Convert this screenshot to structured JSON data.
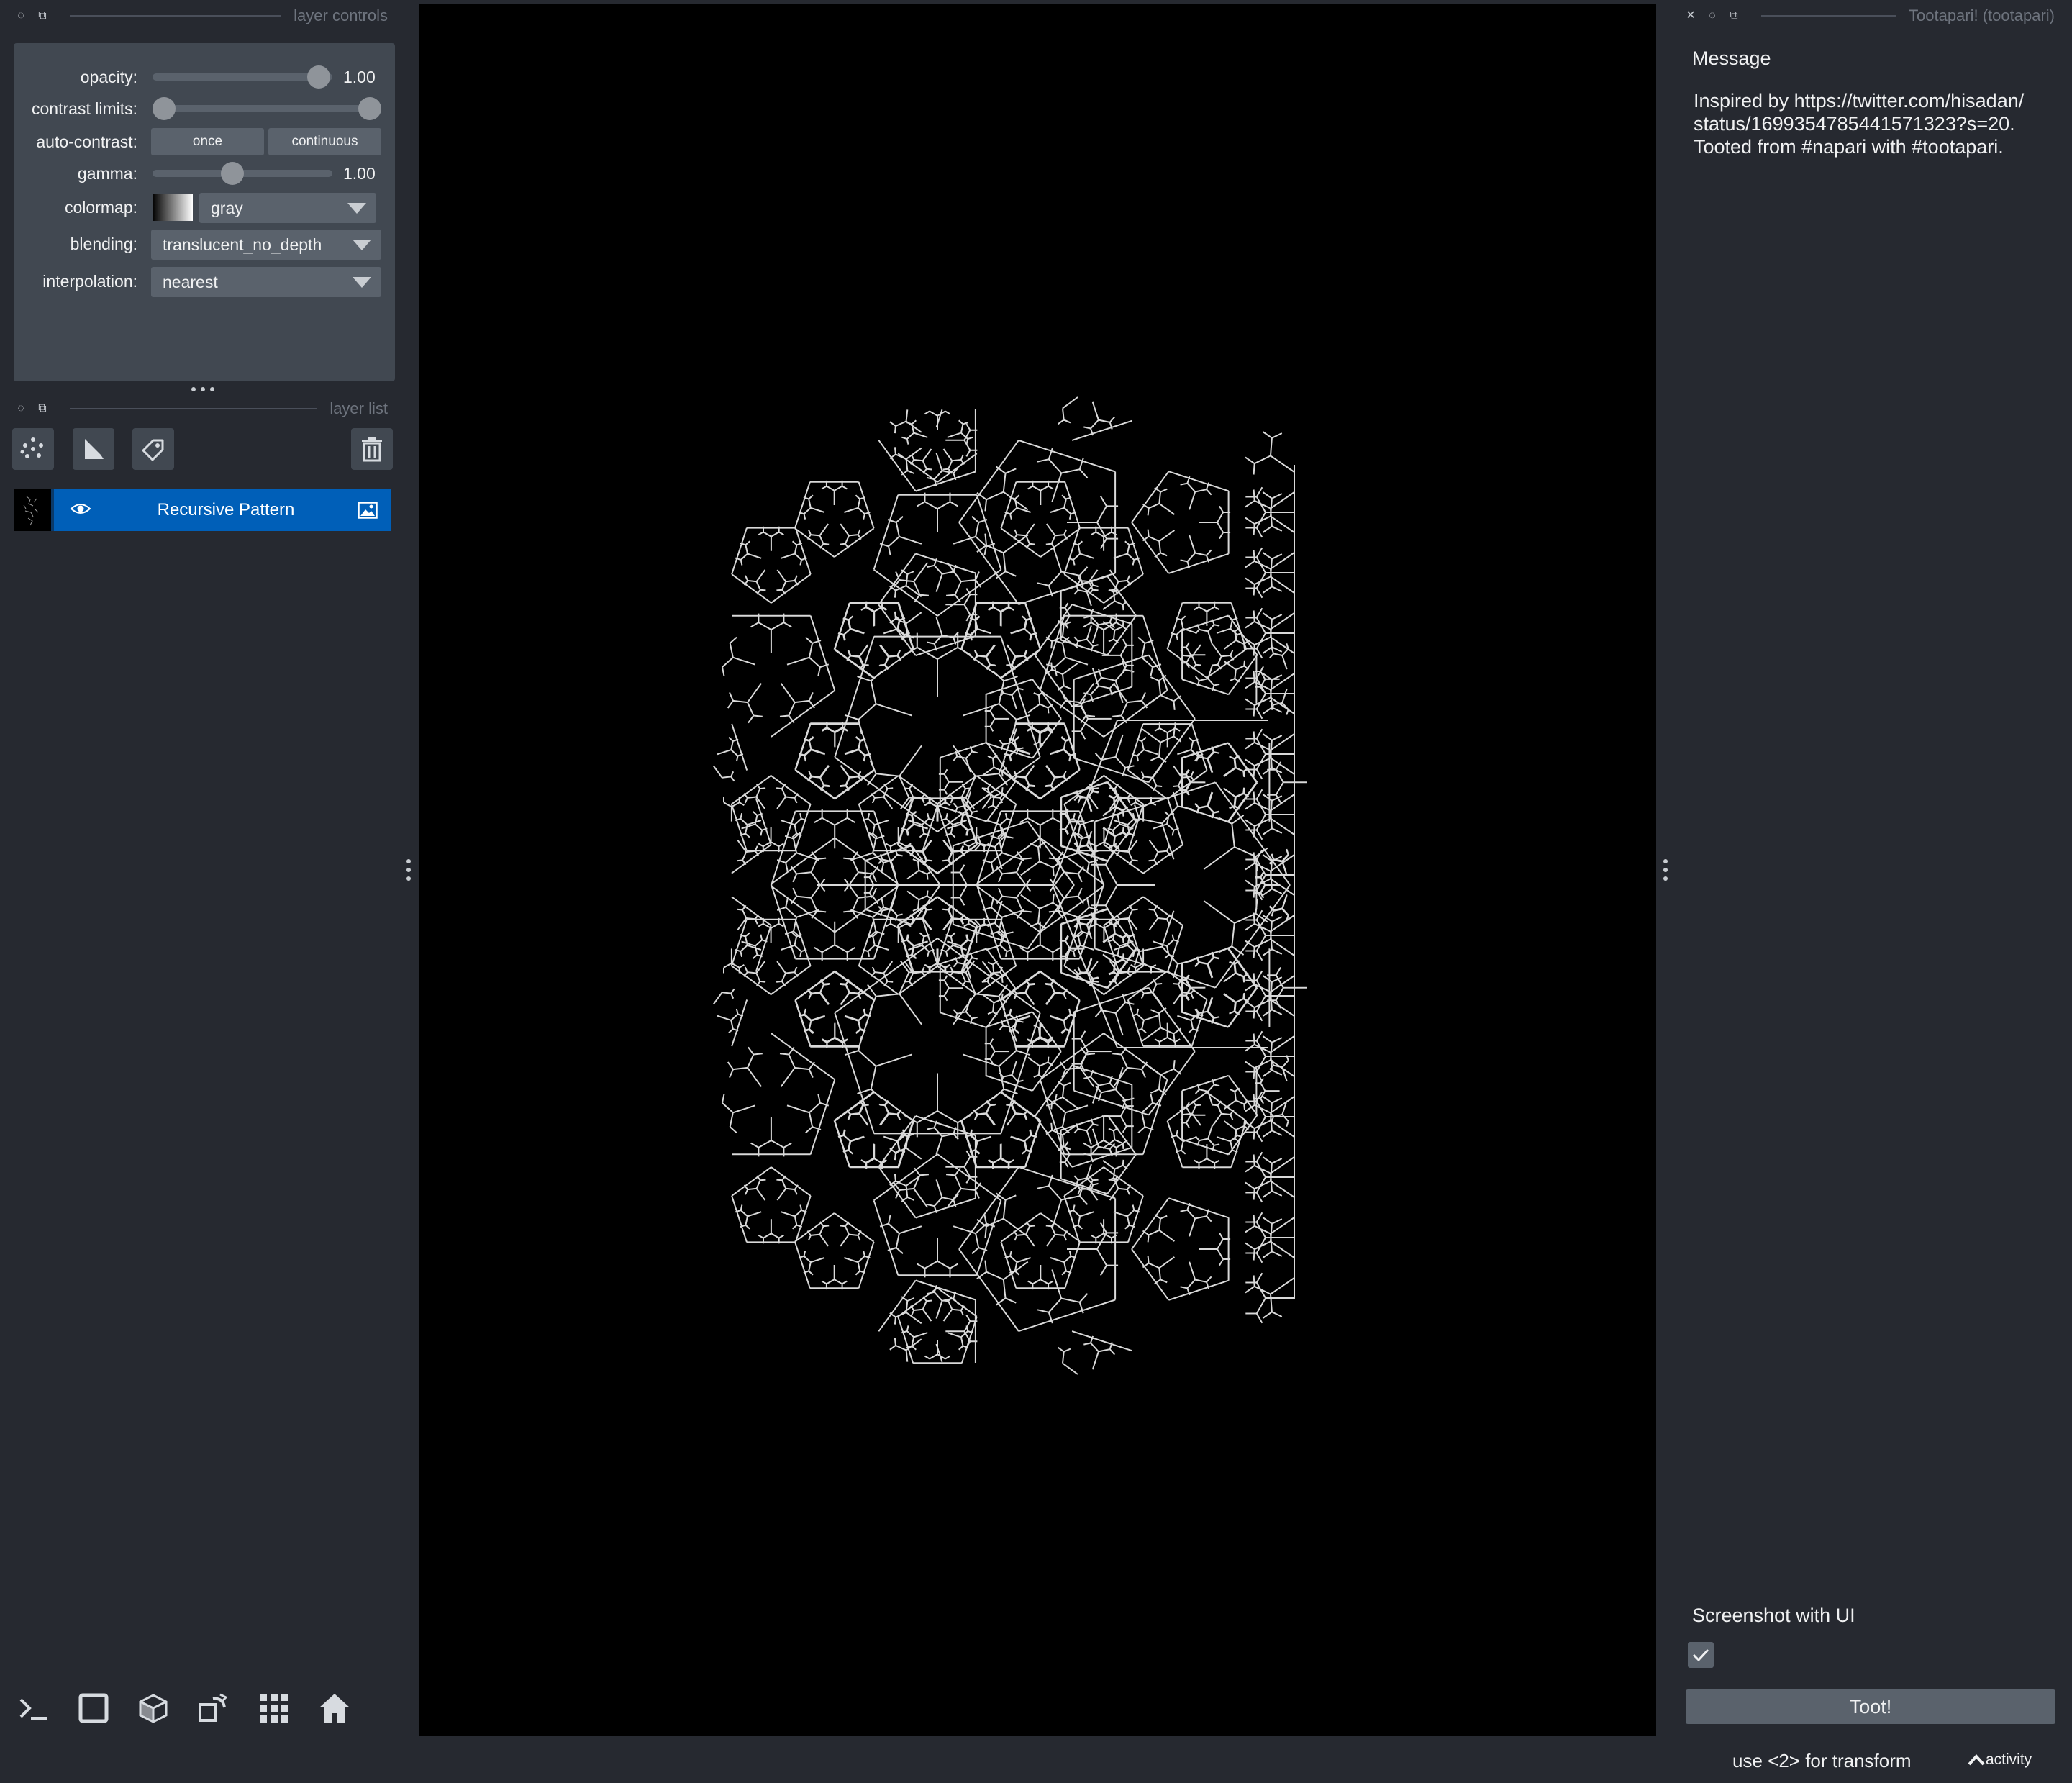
{
  "layer_controls": {
    "title": "layer controls",
    "opacity": {
      "label": "opacity:",
      "value": "1.00",
      "level": 1.0
    },
    "contrast_limits": {
      "label": "contrast limits:",
      "low": 0.0,
      "high": 1.0
    },
    "auto_contrast": {
      "label": "auto-contrast:",
      "once": "once",
      "continuous": "continuous"
    },
    "gamma": {
      "label": "gamma:",
      "value": "1.00",
      "level": 0.5
    },
    "colormap": {
      "label": "colormap:",
      "value": "gray"
    },
    "blending": {
      "label": "blending:",
      "value": "translucent_no_depth"
    },
    "interpolation": {
      "label": "interpolation:",
      "value": "nearest"
    }
  },
  "layer_list": {
    "title": "layer list",
    "layers": [
      {
        "name": "Recursive Pattern",
        "visible": true,
        "type": "image"
      }
    ]
  },
  "right_dock": {
    "title": "Tootapari! (tootapari)",
    "message_label": "Message",
    "message_lines": [
      "Inspired by https://twitter.com/hisadan/",
      "status/1699354785441571323?s=20.",
      "Tooted from #napari with #tootapari."
    ],
    "screenshot_label": "Screenshot with UI",
    "screenshot_checked": true,
    "toot_button": "Toot!"
  },
  "status_bar": {
    "hint": "use <2> for transform",
    "activity": "activity"
  },
  "colors": {
    "background": "#262930",
    "panel": "#414851",
    "control": "#5a626c",
    "selected_layer": "#005fb8",
    "canvas": "#000000"
  }
}
